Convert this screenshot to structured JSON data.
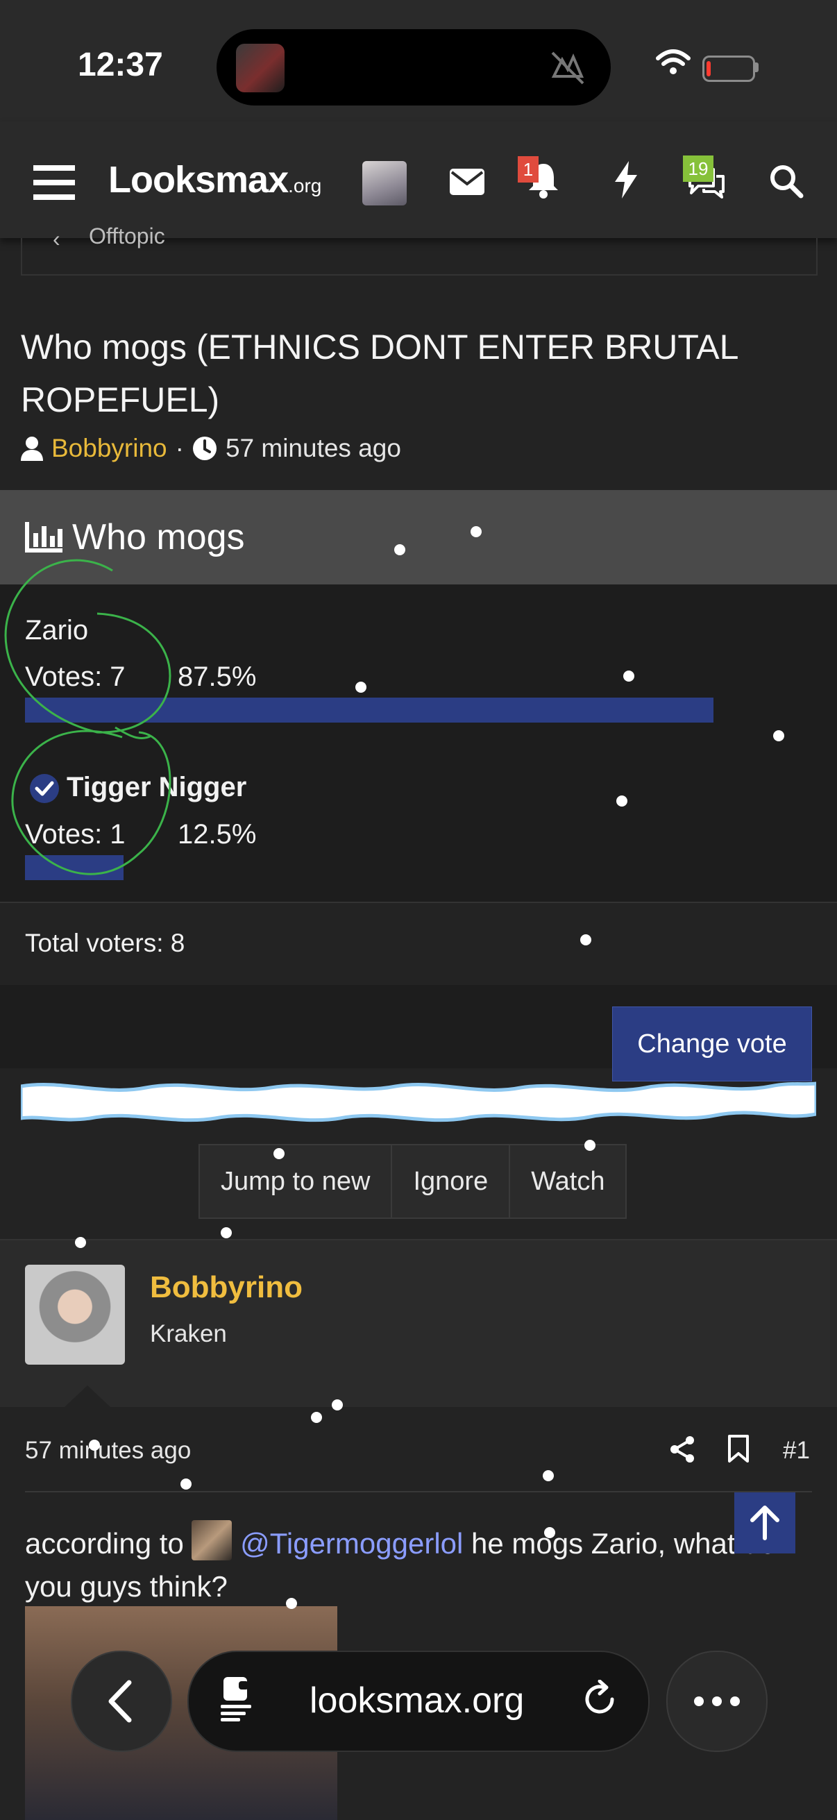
{
  "status_bar": {
    "time": "12:37"
  },
  "nav": {
    "logo": "Looksmax",
    "logo_tld": ".org",
    "notifications_badge": "1",
    "conversations_badge": "19"
  },
  "breadcrumb": {
    "label": "Offtopic"
  },
  "thread": {
    "title": "Who mogs (ETHNICS DONT ENTER BRUTAL ROPEFUEL)",
    "author": "Bobbyrino",
    "time": "57 minutes ago"
  },
  "poll": {
    "title": "Who mogs",
    "options": [
      {
        "name": "Zario",
        "votes_label": "Votes: 7",
        "percent_label": "87.5%",
        "share": 0.875
      },
      {
        "name": "Tigger Nigger",
        "votes_label": "Votes: 1",
        "percent_label": "12.5%",
        "share": 0.125
      }
    ],
    "total_voters": "Total voters: 8",
    "change_vote": "Change vote"
  },
  "thread_actions": [
    "Jump to new",
    "Ignore",
    "Watch"
  ],
  "post": {
    "author": "Bobbyrino",
    "rank": "Kraken",
    "time": "57 minutes ago",
    "number": "#1",
    "text_before": "according to ",
    "mention": "@Tigermoggerlol",
    "text_after": " he mogs Zario, what do you guys think?"
  },
  "browser": {
    "url": "looksmax.org"
  }
}
